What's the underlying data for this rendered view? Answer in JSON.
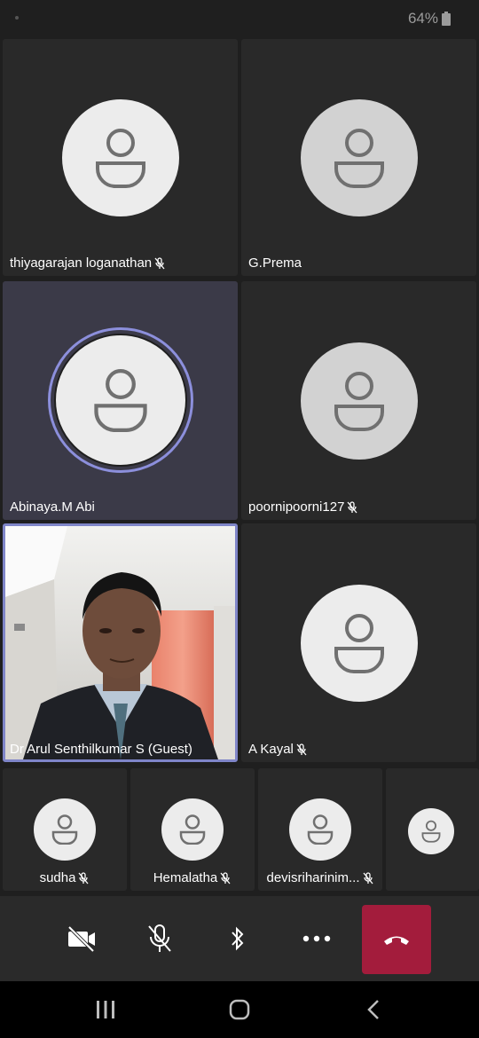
{
  "status_bar": {
    "battery": "64%"
  },
  "participants": [
    {
      "name": "thiyagarajan loganathan",
      "muted": true
    },
    {
      "name": "G.Prema",
      "muted": false
    },
    {
      "name": "Abinaya.M Abi",
      "muted": false,
      "speaking": true
    },
    {
      "name": "poornipoorni127",
      "muted": true
    },
    {
      "name": "Dr Arul Senthilkumar S (Guest)",
      "muted": false,
      "video": true
    },
    {
      "name": "A Kayal",
      "muted": true
    },
    {
      "name": "sudha",
      "muted": true
    },
    {
      "name": "Hemalatha",
      "muted": true
    },
    {
      "name": "devisriharinim...",
      "muted": true
    }
  ],
  "toolbar": {
    "camera": "camera-off-icon",
    "mic": "mic-off-icon",
    "audio": "bluetooth-icon",
    "more": "more-icon",
    "hangup": "hang-up-icon",
    "hangup_color": "#a31c3c"
  },
  "navbar": {
    "recent": "recent-apps-icon",
    "home": "home-icon",
    "back": "back-icon"
  }
}
